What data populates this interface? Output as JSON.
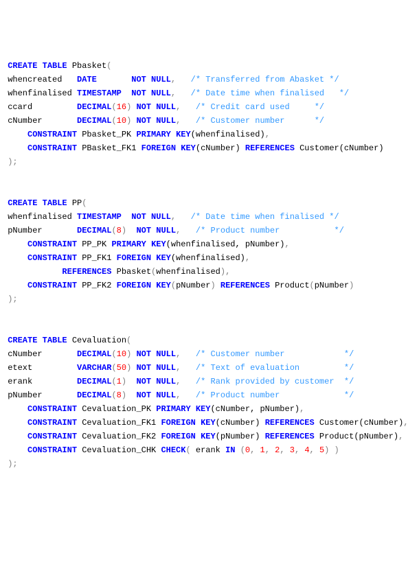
{
  "tables": [
    {
      "name": "Pbasket",
      "columns": [
        {
          "col": "whencreated",
          "type": "DATE",
          "args": "",
          "nn": "NOT NULL",
          "comment": "/* Transferred from Abasket */"
        },
        {
          "col": "whenfinalised",
          "type": "TIMESTAMP",
          "args": "",
          "nn": "NOT NULL",
          "comment": "/* Date time when finalised   */"
        },
        {
          "col": "ccard",
          "type": "DECIMAL",
          "args": "16",
          "nn": "NOT NULL",
          "comment": "/* Credit card used     */"
        },
        {
          "col": "cNumber",
          "type": "DECIMAL",
          "args": "10",
          "nn": "NOT NULL",
          "comment": "/* Customer number      */"
        }
      ],
      "constraints": [
        {
          "name": "Pbasket_PK",
          "kind": "PRIMARY KEY",
          "body": "(whenfinalised)",
          "refs": ""
        },
        {
          "name": "PBasket_FK1",
          "kind": "FOREIGN KEY",
          "body": "(cNumber)",
          "refs": "REFERENCES Customer(cNumber)"
        }
      ],
      "extra_lines": []
    },
    {
      "name": "PP",
      "columns": [
        {
          "col": "whenfinalised",
          "type": "TIMESTAMP",
          "args": "",
          "nn": "NOT NULL",
          "comment": "/* Date time when finalised */"
        },
        {
          "col": "pNumber",
          "type": "DECIMAL",
          "args": "8",
          "nn": "NOT NULL",
          "comment": "/* Product number           */"
        }
      ],
      "constraints": [
        {
          "name": "PP_PK",
          "kind": "PRIMARY KEY",
          "body": "(whenfinalised, pNumber)",
          "refs": ""
        },
        {
          "name": "PP_FK1",
          "kind": "FOREIGN KEY",
          "body": "(whenfinalised)",
          "refs": ""
        }
      ],
      "extra_lines": [
        "            REFERENCES Pbasket(whenfinalised),",
        "     CONSTRAINT PP_FK2 FOREIGN KEY(pNumber) REFERENCES Product(pNumber)"
      ]
    },
    {
      "name": "Cevaluation",
      "columns": [
        {
          "col": "cNumber",
          "type": "DECIMAL",
          "args": "10",
          "nn": "NOT NULL",
          "comment": "/* Customer number            */"
        },
        {
          "col": "etext",
          "type": "VARCHAR",
          "args": "50",
          "nn": "NOT NULL",
          "comment": "/* Text of evaluation         */"
        },
        {
          "col": "erank",
          "type": "DECIMAL",
          "args": "1",
          "nn": "NOT NULL",
          "comment": "/* Rank provided by customer  */"
        },
        {
          "col": "pNumber",
          "type": "DECIMAL",
          "args": "8",
          "nn": "NOT NULL",
          "comment": "/* Product number             */"
        }
      ],
      "constraints": [
        {
          "name": "Cevaluation_PK",
          "kind": "PRIMARY KEY",
          "body": "(cNumber, pNumber)",
          "refs": ""
        },
        {
          "name": "Cevaluation_FK1",
          "kind": "FOREIGN KEY",
          "body": "(cNumber)",
          "refs": "REFERENCES Customer(cNumber)"
        },
        {
          "name": "Cevaluation_FK2",
          "kind": "FOREIGN KEY",
          "body": "(pNumber)",
          "refs": "REFERENCES Product(pNumber)"
        },
        {
          "name": "Cevaluation_CHK",
          "kind": "CHECK",
          "body": "( erank IN (0, 1, 2, 3, 4, 5) )",
          "refs": ""
        }
      ],
      "extra_lines": []
    }
  ],
  "kw": {
    "create": "CREATE TABLE",
    "constraint": "CONSTRAINT",
    "pk": "PRIMARY KEY",
    "fk": "FOREIGN KEY",
    "ref": "REFERENCES",
    "check": "CHECK",
    "in": "IN",
    "nn": "NOT NULL"
  },
  "close": " );"
}
